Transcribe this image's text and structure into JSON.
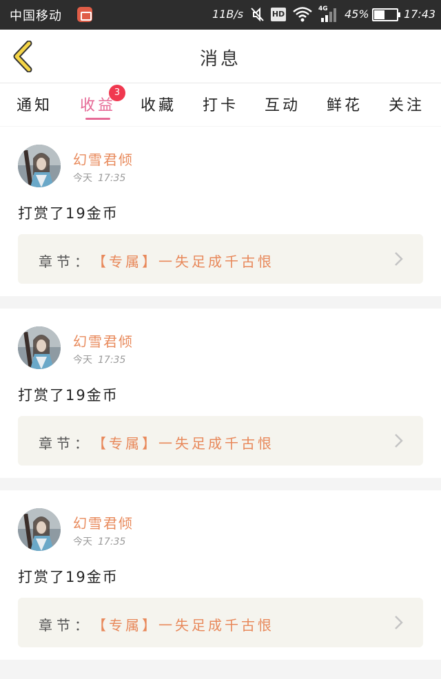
{
  "status_bar": {
    "carrier": "中国移动",
    "net_speed": "11B/s",
    "hd_label": "HD",
    "network_type": "4G",
    "battery_percent": "45%",
    "time": "17:43"
  },
  "header": {
    "title": "消息"
  },
  "tabs": [
    {
      "label": "通知"
    },
    {
      "label": "收益",
      "active": true,
      "badge": "3"
    },
    {
      "label": "收藏"
    },
    {
      "label": "打卡"
    },
    {
      "label": "互动"
    },
    {
      "label": "鲜花"
    },
    {
      "label": "关注"
    }
  ],
  "messages": [
    {
      "username": "幻雪君倾",
      "date": "今天",
      "time": "17:35",
      "text": "打赏了19金币",
      "chapter_label": "章节：",
      "chapter_title": "【专属】一失足成千古恨"
    },
    {
      "username": "幻雪君倾",
      "date": "今天",
      "time": "17:35",
      "text": "打赏了19金币",
      "chapter_label": "章节：",
      "chapter_title": "【专属】一失足成千古恨"
    },
    {
      "username": "幻雪君倾",
      "date": "今天",
      "time": "17:35",
      "text": "打赏了19金币",
      "chapter_label": "章节：",
      "chapter_title": "【专属】一失足成千古恨"
    }
  ],
  "colors": {
    "accent_pink": "#e66a96",
    "username_orange": "#e88a5c",
    "badge_red": "#f0384f",
    "status_bar_bg": "#2d2d2d",
    "chapter_box_bg": "#f5f4ee",
    "back_icon_yellow": "#f5d547"
  },
  "icons": {
    "back": "back-arrow-icon",
    "mute": "mute-icon",
    "wifi": "wifi-icon",
    "signal": "signal-icon",
    "battery": "battery-icon",
    "chevron": "chevron-right-icon"
  }
}
